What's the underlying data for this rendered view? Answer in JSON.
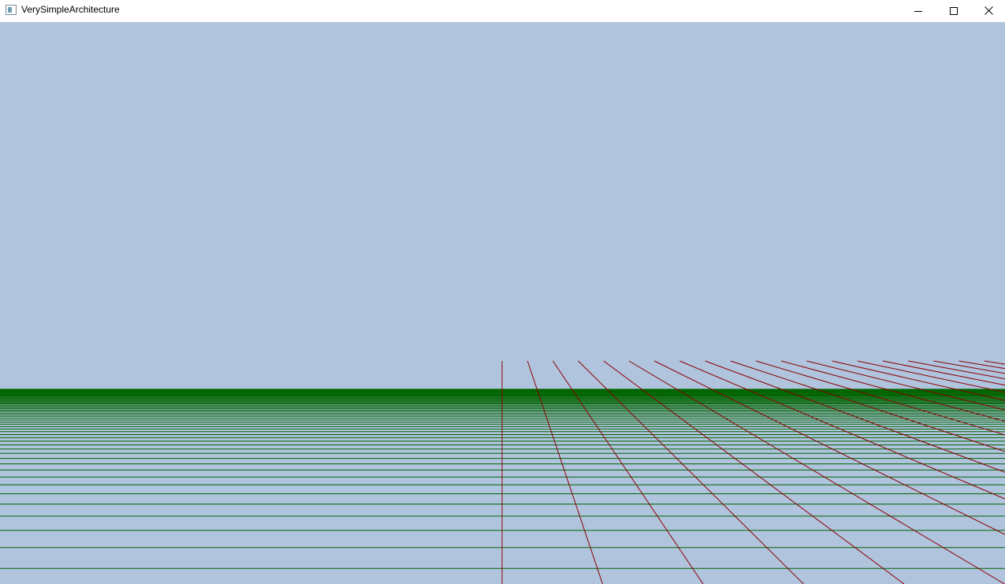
{
  "window": {
    "title": "VerySimpleArchitecture",
    "controls": {
      "minimize_icon": "minimize-icon",
      "maximize_icon": "maximize-icon",
      "close_icon": "close-icon"
    }
  },
  "scene": {
    "background_color": "#b0c4de",
    "floor_grid": {
      "lateral_line_color": "#006400",
      "depth_line_color": "#8b0000"
    }
  }
}
